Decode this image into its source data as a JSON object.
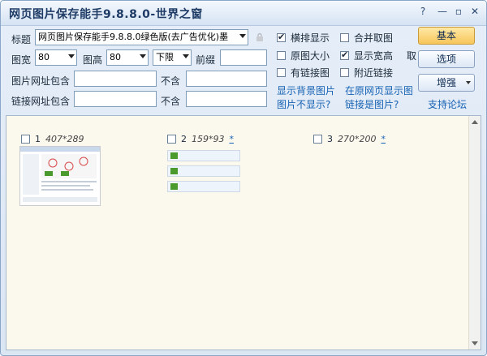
{
  "window": {
    "title": "网页图片保存能手9.8.8.0-世界之窗",
    "help_glyph": "?",
    "minimize_glyph": "—",
    "restore_glyph": "▫",
    "close_glyph": "✕"
  },
  "form": {
    "title_label": "标题",
    "title_value": "网页图片保存能手9.8.8.0绿色版(去广告优化)墨",
    "width_label": "图宽",
    "width_value": "80",
    "height_label": "图高",
    "height_value": "80",
    "limit_value": "下限",
    "prefix_label": "前缀",
    "prefix_value": "",
    "img_url_label": "图片网址包含",
    "img_url_value": "",
    "img_exclude_label": "不含",
    "img_exclude_value": "",
    "link_url_label": "链接网址包含",
    "link_url_value": "",
    "link_exclude_label": "不含",
    "link_exclude_value": ""
  },
  "options": [
    {
      "label": "横排显示",
      "checked": true
    },
    {
      "label": "合并取图",
      "checked": false
    },
    {
      "label": "原图大小",
      "checked": false
    },
    {
      "label": "显示宽高",
      "checked": true
    },
    {
      "label": "有链接图",
      "checked": false
    },
    {
      "label": "附近链接",
      "checked": false
    }
  ],
  "extra_glyph": "取",
  "links": {
    "bg_image_1": "显示背景图片",
    "bg_image_2": "图片不显示?",
    "original_1": "在原网页显示图",
    "original_2": "链接是图片?",
    "forum": "支持论坛"
  },
  "buttons": {
    "basic": "基本",
    "options": "选项",
    "enhance": "增强"
  },
  "results": [
    {
      "num": "1",
      "dims": "407*289",
      "star": ""
    },
    {
      "num": "2",
      "dims": "159*93",
      "star": "*"
    },
    {
      "num": "3",
      "dims": "270*200",
      "star": "*"
    }
  ],
  "colors": {
    "accent": "#f7c55a",
    "link": "#1762b3",
    "content_bg": "#fbf8ee"
  }
}
